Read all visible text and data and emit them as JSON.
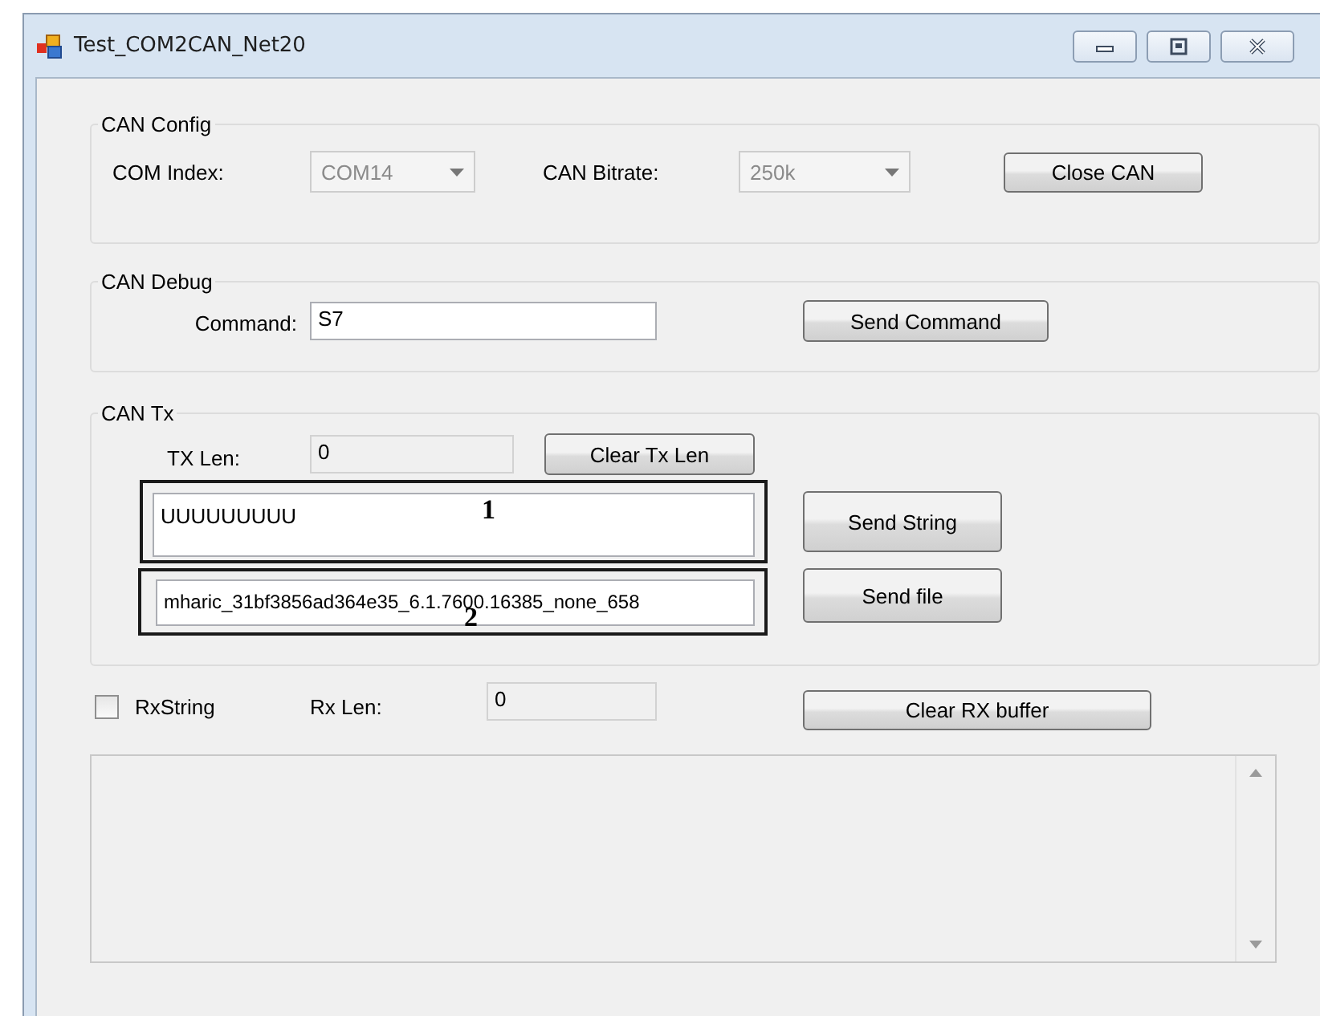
{
  "window": {
    "title": "Test_COM2CAN_Net20"
  },
  "can_config": {
    "title": "CAN Config",
    "com_index": {
      "label": "COM Index:",
      "value": "COM14",
      "disabled": true
    },
    "can_bitrate": {
      "label": "CAN Bitrate:",
      "value": "250k",
      "disabled": true
    },
    "button": "Close CAN"
  },
  "can_debug": {
    "title": "CAN Debug",
    "command": {
      "label": "Command:",
      "value": "S7"
    },
    "button": "Send Command"
  },
  "can_tx": {
    "title": "CAN Tx",
    "tx_len": {
      "label": "TX Len:",
      "value": "0",
      "read_only": true
    },
    "clear_button": "Clear Tx Len",
    "string_field": {
      "value": "UUUUUUUUU"
    },
    "send_string_button": "Send String",
    "file_field": {
      "value": "mharic_31bf3856ad364e35_6.1.7600.16385_none_658"
    },
    "send_file_button": "Send file"
  },
  "rx": {
    "checkbox": {
      "label": "RxString",
      "checked": false
    },
    "rx_len": {
      "label": "Rx Len:",
      "value": "0",
      "read_only": true
    },
    "clear_button": "Clear RX buffer"
  },
  "annotations": [
    {
      "label": "1"
    },
    {
      "label": "2"
    }
  ]
}
